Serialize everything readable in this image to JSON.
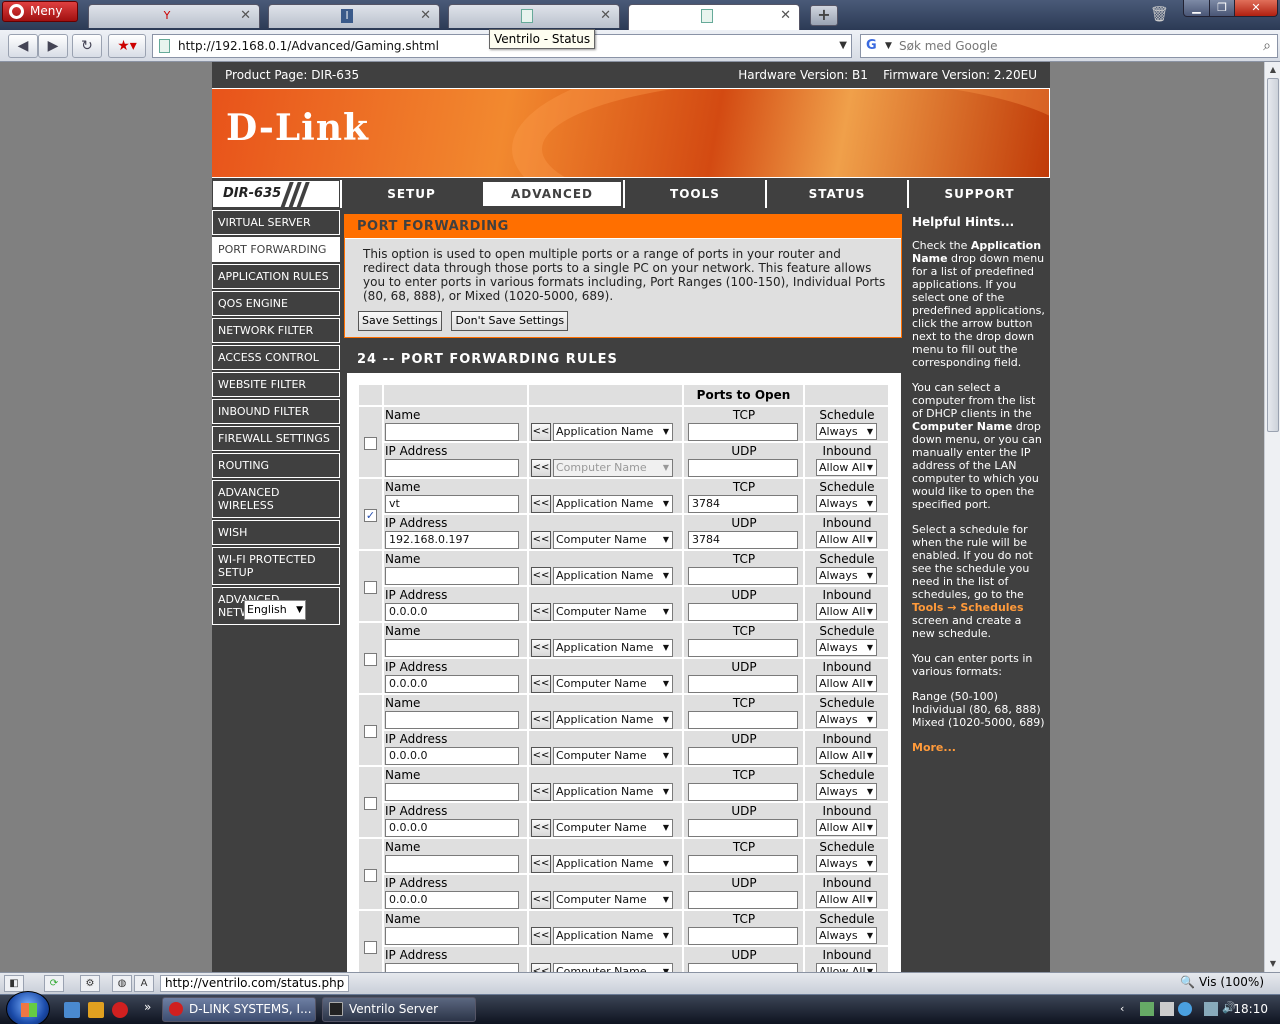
{
  "browser": {
    "menu_label": "Meny",
    "tooltip": "Ventrilo - Status",
    "url": "http://192.168.0.1/Advanced/Gaming.shtml",
    "search_placeholder": "Søk med Google"
  },
  "router": {
    "product_page": "Product Page: DIR-635",
    "hw_version": "Hardware Version: B1",
    "fw_version": "Firmware Version: 2.20EU",
    "logo": "D-Link",
    "model": "DIR-635",
    "topnav": [
      "SETUP",
      "ADVANCED",
      "TOOLS",
      "STATUS",
      "SUPPORT"
    ],
    "leftnav": [
      "VIRTUAL SERVER",
      "PORT FORWARDING",
      "APPLICATION RULES",
      "QOS ENGINE",
      "NETWORK FILTER",
      "ACCESS CONTROL",
      "WEBSITE FILTER",
      "INBOUND FILTER",
      "FIREWALL SETTINGS",
      "ROUTING",
      "ADVANCED WIRELESS",
      "WISH",
      "WI-FI PROTECTED SETUP",
      "ADVANCED NETWORK"
    ],
    "language": "English"
  },
  "port_forwarding": {
    "title": "PORT FORWARDING",
    "description": "This option is used to open multiple ports or a range of ports in your router and redirect data through those ports to a single PC on your network. This feature allows you to enter ports in various formats including, Port Ranges (100-150), Individual Ports (80, 68, 888), or Mixed (1020-5000, 689).",
    "save_button": "Save Settings",
    "dont_save_button": "Don't Save Settings"
  },
  "rules": {
    "title": "24 -- PORT FORWARDING RULES",
    "ports_to_open": "Ports to Open",
    "labels": {
      "name": "Name",
      "ip": "IP Address",
      "tcp": "TCP",
      "udp": "UDP",
      "schedule": "Schedule",
      "inbound": "Inbound Filter",
      "arrow": "<<",
      "app_name": "Application Name",
      "comp_name": "Computer Name",
      "always": "Always",
      "allow_all": "Allow All"
    },
    "rows": [
      {
        "checked": "",
        "name": "",
        "ip": "",
        "tcp": "",
        "udp": ""
      },
      {
        "checked": "✓",
        "name": "vt",
        "ip": "192.168.0.197",
        "tcp": "3784",
        "udp": "3784"
      },
      {
        "checked": "",
        "name": "",
        "ip": "0.0.0.0",
        "tcp": "",
        "udp": ""
      },
      {
        "checked": "",
        "name": "",
        "ip": "0.0.0.0",
        "tcp": "",
        "udp": ""
      },
      {
        "checked": "",
        "name": "",
        "ip": "0.0.0.0",
        "tcp": "",
        "udp": ""
      },
      {
        "checked": "",
        "name": "",
        "ip": "0.0.0.0",
        "tcp": "",
        "udp": ""
      },
      {
        "checked": "",
        "name": "",
        "ip": "0.0.0.0",
        "tcp": "",
        "udp": ""
      },
      {
        "checked": "",
        "name": "",
        "ip": "",
        "tcp": "",
        "udp": ""
      }
    ]
  },
  "hints": {
    "title": "Helpful Hints...",
    "p1a": "Check the ",
    "p1b": "Application Name",
    "p1c": " drop down menu for a list of predefined applications. If you select one of the predefined applications, click the arrow button next to the drop down menu to fill out the corresponding field.",
    "p2a": "You can select a computer from the list of DHCP clients in the ",
    "p2b": "Computer Name",
    "p2c": " drop down menu, or you can manually enter the IP address of the LAN computer to which you would like to open the specified port.",
    "p3a": "Select a schedule for when the rule will be enabled. If you do not see the schedule you need in the list of schedules, go to the ",
    "p3b": "Tools → Schedules",
    "p3c": " screen and create a new schedule.",
    "p4": "You can enter ports in various formats:",
    "f1": "Range (50-100)",
    "f2": "Individual (80, 68, 888)",
    "f3": "Mixed (1020-5000, 689)",
    "more": "More..."
  },
  "statusbar": {
    "url": "http://ventrilo.com/status.php",
    "zoom": "Vis (100%)"
  },
  "taskbar": {
    "task1": "D-LINK SYSTEMS, I...",
    "task2": "Ventrilo Server",
    "clock": "18:10"
  },
  "colors": {
    "accent_orange": "#ff6f00",
    "panel_dark": "#404040"
  }
}
